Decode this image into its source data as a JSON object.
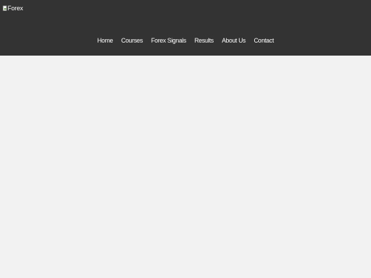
{
  "header": {
    "logo_alt": "Forex"
  },
  "nav": {
    "items": [
      {
        "label": "Home"
      },
      {
        "label": "Courses"
      },
      {
        "label": "Forex Signals"
      },
      {
        "label": "Results"
      },
      {
        "label": "About Us"
      },
      {
        "label": "Contact"
      }
    ]
  },
  "colors": {
    "header_bg": "#333333",
    "page_bg": "#f2f2f2",
    "nav_text": "#ffffff"
  }
}
